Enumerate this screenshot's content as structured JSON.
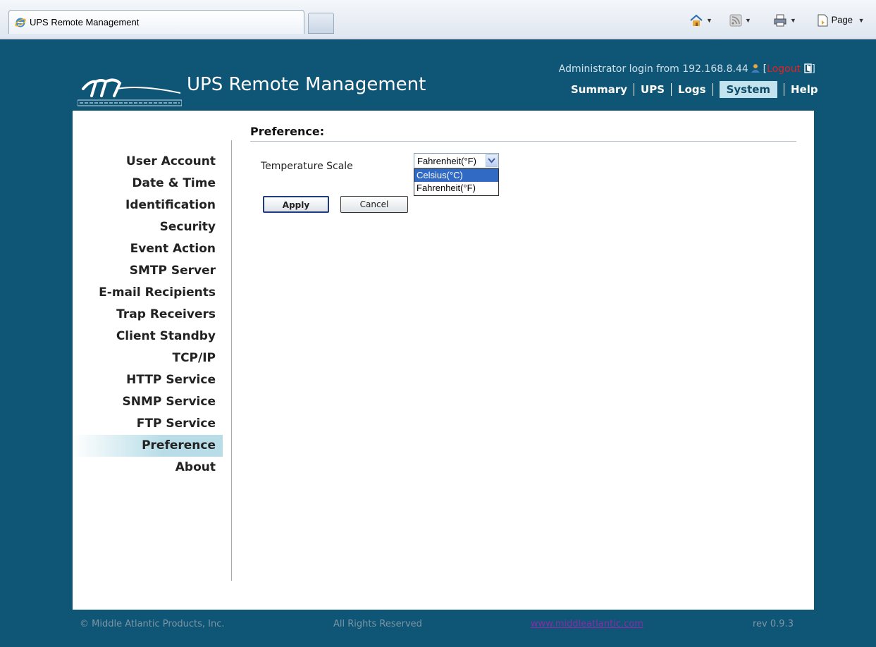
{
  "browser": {
    "tab_title": "UPS Remote Management",
    "toolbar": {
      "page_label": "Page"
    }
  },
  "header": {
    "title": "UPS Remote Management",
    "login_text": "Administrator login from 192.168.8.44",
    "logout_label": "Logout",
    "nav": [
      {
        "label": "Summary"
      },
      {
        "label": "UPS"
      },
      {
        "label": "Logs"
      },
      {
        "label": "System",
        "active": true
      },
      {
        "label": "Help"
      }
    ]
  },
  "sidebar": {
    "items": [
      {
        "label": "User Account"
      },
      {
        "label": "Date & Time"
      },
      {
        "label": "Identification"
      },
      {
        "label": "Security"
      },
      {
        "label": "Event Action"
      },
      {
        "label": "SMTP Server"
      },
      {
        "label": "E-mail Recipients"
      },
      {
        "label": "Trap Receivers"
      },
      {
        "label": "Client Standby"
      },
      {
        "label": "TCP/IP"
      },
      {
        "label": "HTTP Service"
      },
      {
        "label": "SNMP Service"
      },
      {
        "label": "FTP Service"
      },
      {
        "label": "Preference",
        "active": true
      },
      {
        "label": "About"
      }
    ]
  },
  "main": {
    "section_title": "Preference:",
    "temperature": {
      "label": "Temperature Scale",
      "selected": "Fahrenheit(°F)",
      "options": [
        "Celsius(°C)",
        "Fahrenheit(°F)"
      ]
    },
    "apply_label": "Apply",
    "cancel_label": "Cancel"
  },
  "footer": {
    "copyright": "© Middle Atlantic Products, Inc.",
    "rights": "All Rights Reserved",
    "website": "www.middleatlantic.com",
    "revision": "rev 0.9.3"
  },
  "colors": {
    "background": "#0f5576",
    "nav_active": "#c3e3ee",
    "sidebar_active": "#b8dde8",
    "logout": "#e32222",
    "option_highlight": "#316ac5"
  }
}
